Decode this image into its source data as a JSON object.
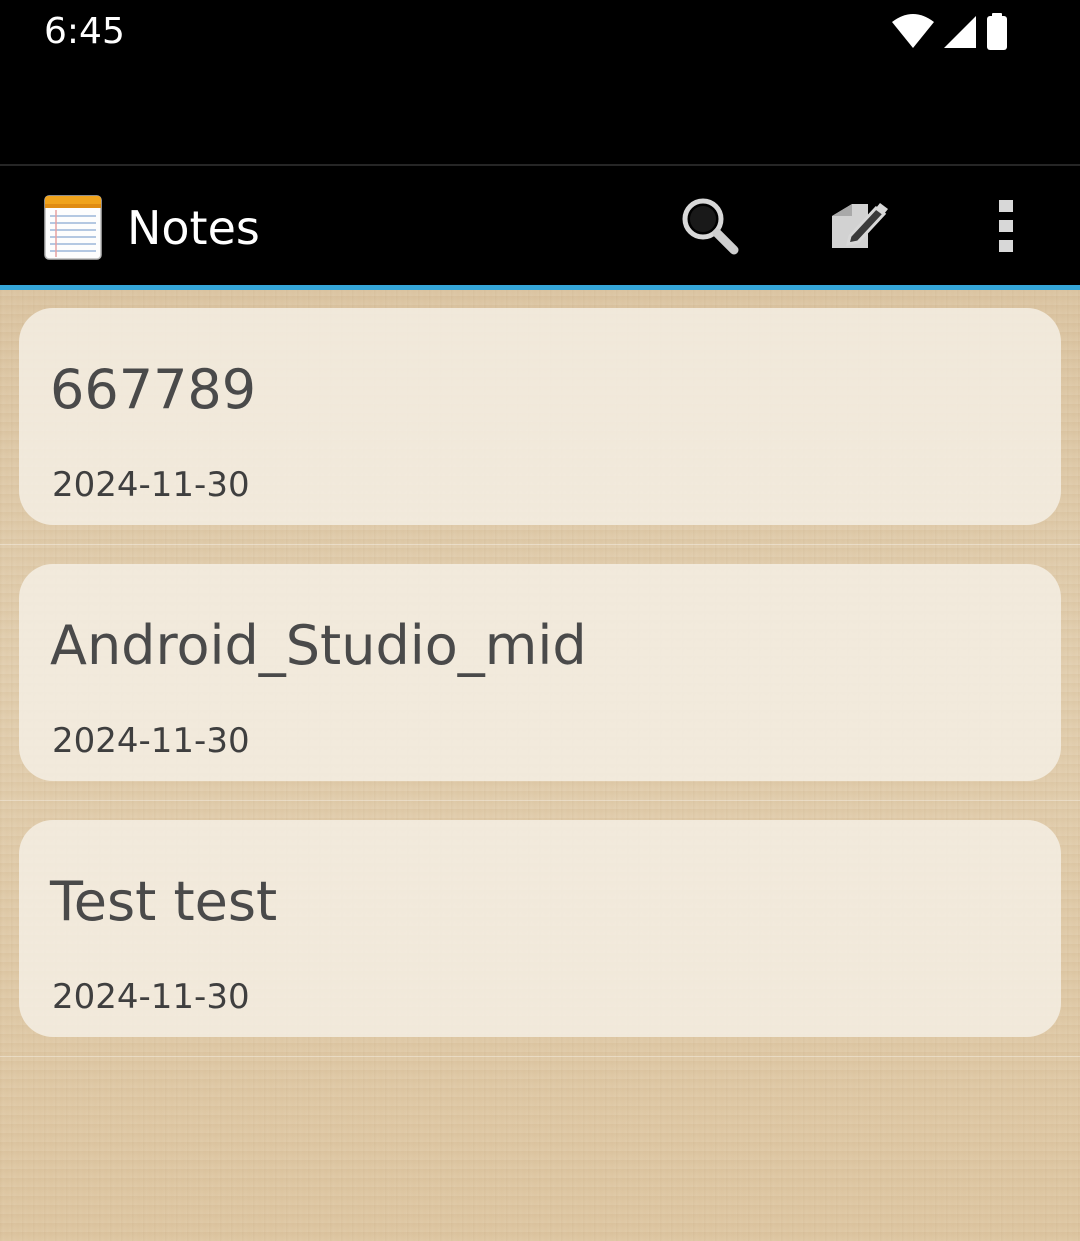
{
  "status_bar": {
    "time": "6:45",
    "icons": [
      "wifi-icon",
      "signal-icon",
      "battery-icon"
    ]
  },
  "action_bar": {
    "title": "Notes",
    "icons": [
      "notepad-icon",
      "search-icon",
      "compose-icon",
      "overflow-menu-icon"
    ]
  },
  "colors": {
    "accent": "#35a6d8",
    "action_bar_bg": "#000000",
    "card_bg": "#f4eee4",
    "title_text": "#4a4a4a"
  },
  "notes": [
    {
      "title": "667789",
      "date": "2024-11-30"
    },
    {
      "title": "Android_Studio_mid",
      "date": "2024-11-30"
    },
    {
      "title": "Test test",
      "date": "2024-11-30"
    }
  ]
}
